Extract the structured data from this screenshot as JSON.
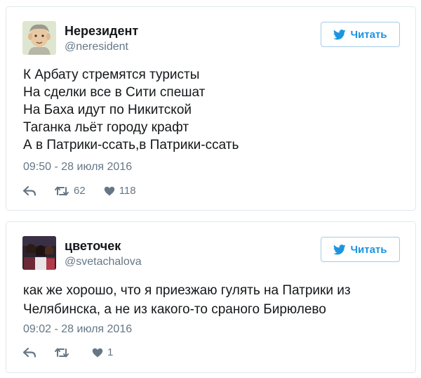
{
  "tweets": [
    {
      "author": {
        "name": "Нерезидент",
        "handle": "@neresident"
      },
      "follow_label": "Читать",
      "lines": [
        "К Арбату стремятся туристы",
        "На сделки все в Сити спешат",
        "На Баха идут по Никитской",
        "Таганка льёт городу крафт",
        "А в Патрики-ссать,в Патрики-ссать"
      ],
      "timestamp": "09:50 - 28 июля 2016",
      "actions": {
        "reply_count": "",
        "retweet_count": "62",
        "like_count": "118"
      }
    },
    {
      "author": {
        "name": "цветочек",
        "handle": "@svetachalova"
      },
      "follow_label": "Читать",
      "lines": [
        "как же хорошо, что я приезжаю гулять на Патрики из",
        "Челябинска, а не из какого-то сраного Бирюлево"
      ],
      "timestamp": "09:02 - 28 июля 2016",
      "actions": {
        "reply_count": "",
        "retweet_count": "",
        "like_count": "1"
      }
    }
  ],
  "colors": {
    "accent": "#1b95e0",
    "muted": "#657786",
    "border": "#e1e8ed",
    "text": "#14171a"
  },
  "icons": {
    "follow": "twitter-bird-icon",
    "reply": "reply-icon",
    "retweet": "retweet-icon",
    "like": "heart-icon"
  }
}
